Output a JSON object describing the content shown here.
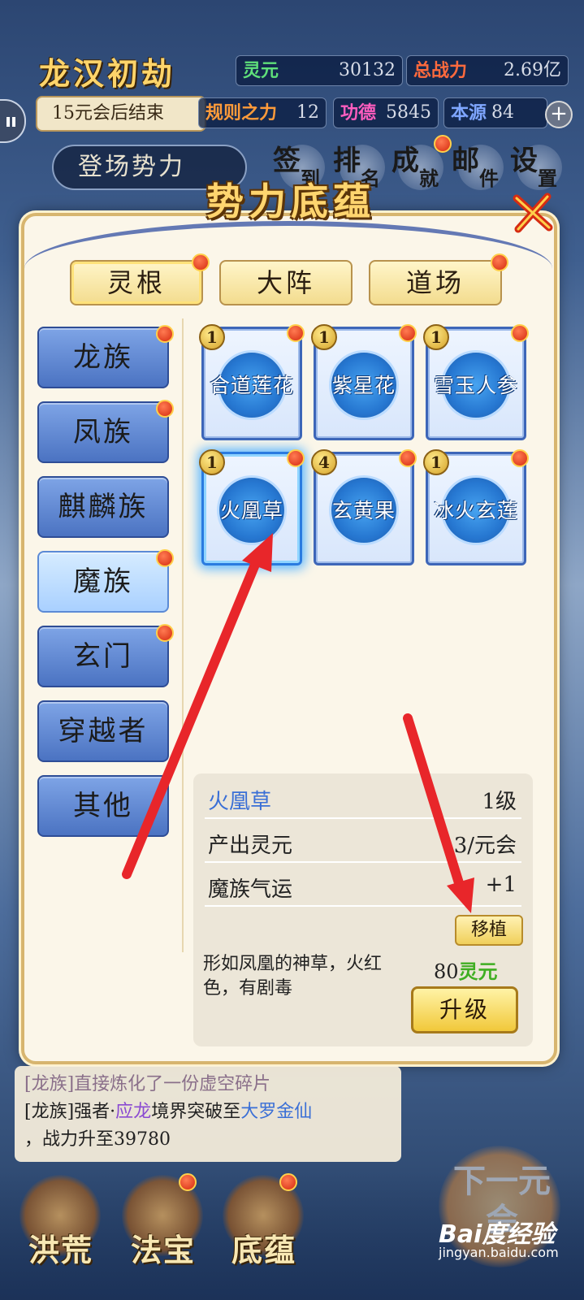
{
  "hud": {
    "stage_title": "龙汉初劫",
    "timer": "15元会后结束",
    "stats": [
      {
        "label": "灵元",
        "value": "30132",
        "color": "#5fe07a"
      },
      {
        "label": "总战力",
        "value": "2.69亿",
        "color": "#ff6a3d"
      },
      {
        "label": "规则之力",
        "value": "12",
        "color": "#ff9b3a"
      },
      {
        "label": "功德",
        "value": "5845",
        "color": "#ff5dbf"
      },
      {
        "label": "本源",
        "value": "84",
        "color": "#7fa6ff"
      }
    ],
    "power_button": "登场势力",
    "menu": [
      {
        "big": "签",
        "small": "到"
      },
      {
        "big": "排",
        "small": "名"
      },
      {
        "big": "成",
        "small": "就"
      },
      {
        "big": "邮",
        "small": "件"
      },
      {
        "big": "设",
        "small": "置"
      }
    ]
  },
  "modal": {
    "title": "势力底蕴",
    "top_tabs": [
      "灵根",
      "大阵",
      "道场"
    ],
    "left_tabs": [
      "龙族",
      "凤族",
      "麒麟族",
      "魔族",
      "玄门",
      "穿越者",
      "其他"
    ],
    "cards": [
      {
        "name": "合道莲花",
        "level": "1"
      },
      {
        "name": "紫星花",
        "level": "1"
      },
      {
        "name": "雪玉人参",
        "level": "1"
      },
      {
        "name": "火凰草",
        "level": "1"
      },
      {
        "name": "玄黄果",
        "level": "4"
      },
      {
        "name": "冰火玄莲",
        "level": "1"
      }
    ],
    "detail": {
      "name": "火凰草",
      "level": "1级",
      "rows": [
        {
          "label": "产出灵元",
          "value": "3/元会"
        },
        {
          "label": "魔族气运",
          "value": "+1"
        }
      ],
      "move_button": "移植",
      "description": "形如凤凰的神草，火红色，有剧毒",
      "cost_amount": "80",
      "cost_unit": "灵元",
      "upgrade_button": "升级"
    }
  },
  "log": {
    "line1": "[龙族]直接炼化了一份虚空碎片",
    "line2_prefix": "[龙族]强者·",
    "line2_name": "应龙",
    "line2_mid": "境界突破至",
    "line2_realm": "大罗金仙",
    "line3": "，战力升至39780"
  },
  "bottom_nav": [
    "洪荒",
    "法宝",
    "底蕴"
  ],
  "next_button": "下一元会",
  "watermark": {
    "brand": "Bai度经验",
    "url": "jingyan.baidu.com"
  },
  "colors": {
    "accent_gold": "#d7b56f",
    "tab_blue": "#4b73c2",
    "arrow_red": "#e8262a",
    "notify_red": "#d52a0f"
  }
}
